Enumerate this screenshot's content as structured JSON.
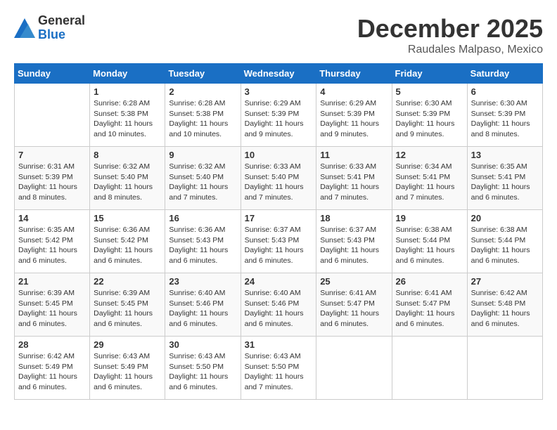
{
  "logo": {
    "general": "General",
    "blue": "Blue"
  },
  "title": {
    "month": "December 2025",
    "location": "Raudales Malpaso, Mexico"
  },
  "headers": [
    "Sunday",
    "Monday",
    "Tuesday",
    "Wednesday",
    "Thursday",
    "Friday",
    "Saturday"
  ],
  "weeks": [
    [
      {
        "day": "",
        "sunrise": "",
        "sunset": "",
        "daylight": ""
      },
      {
        "day": "1",
        "sunrise": "Sunrise: 6:28 AM",
        "sunset": "Sunset: 5:38 PM",
        "daylight": "Daylight: 11 hours and 10 minutes."
      },
      {
        "day": "2",
        "sunrise": "Sunrise: 6:28 AM",
        "sunset": "Sunset: 5:38 PM",
        "daylight": "Daylight: 11 hours and 10 minutes."
      },
      {
        "day": "3",
        "sunrise": "Sunrise: 6:29 AM",
        "sunset": "Sunset: 5:39 PM",
        "daylight": "Daylight: 11 hours and 9 minutes."
      },
      {
        "day": "4",
        "sunrise": "Sunrise: 6:29 AM",
        "sunset": "Sunset: 5:39 PM",
        "daylight": "Daylight: 11 hours and 9 minutes."
      },
      {
        "day": "5",
        "sunrise": "Sunrise: 6:30 AM",
        "sunset": "Sunset: 5:39 PM",
        "daylight": "Daylight: 11 hours and 9 minutes."
      },
      {
        "day": "6",
        "sunrise": "Sunrise: 6:30 AM",
        "sunset": "Sunset: 5:39 PM",
        "daylight": "Daylight: 11 hours and 8 minutes."
      }
    ],
    [
      {
        "day": "7",
        "sunrise": "Sunrise: 6:31 AM",
        "sunset": "Sunset: 5:39 PM",
        "daylight": "Daylight: 11 hours and 8 minutes."
      },
      {
        "day": "8",
        "sunrise": "Sunrise: 6:32 AM",
        "sunset": "Sunset: 5:40 PM",
        "daylight": "Daylight: 11 hours and 8 minutes."
      },
      {
        "day": "9",
        "sunrise": "Sunrise: 6:32 AM",
        "sunset": "Sunset: 5:40 PM",
        "daylight": "Daylight: 11 hours and 7 minutes."
      },
      {
        "day": "10",
        "sunrise": "Sunrise: 6:33 AM",
        "sunset": "Sunset: 5:40 PM",
        "daylight": "Daylight: 11 hours and 7 minutes."
      },
      {
        "day": "11",
        "sunrise": "Sunrise: 6:33 AM",
        "sunset": "Sunset: 5:41 PM",
        "daylight": "Daylight: 11 hours and 7 minutes."
      },
      {
        "day": "12",
        "sunrise": "Sunrise: 6:34 AM",
        "sunset": "Sunset: 5:41 PM",
        "daylight": "Daylight: 11 hours and 7 minutes."
      },
      {
        "day": "13",
        "sunrise": "Sunrise: 6:35 AM",
        "sunset": "Sunset: 5:41 PM",
        "daylight": "Daylight: 11 hours and 6 minutes."
      }
    ],
    [
      {
        "day": "14",
        "sunrise": "Sunrise: 6:35 AM",
        "sunset": "Sunset: 5:42 PM",
        "daylight": "Daylight: 11 hours and 6 minutes."
      },
      {
        "day": "15",
        "sunrise": "Sunrise: 6:36 AM",
        "sunset": "Sunset: 5:42 PM",
        "daylight": "Daylight: 11 hours and 6 minutes."
      },
      {
        "day": "16",
        "sunrise": "Sunrise: 6:36 AM",
        "sunset": "Sunset: 5:43 PM",
        "daylight": "Daylight: 11 hours and 6 minutes."
      },
      {
        "day": "17",
        "sunrise": "Sunrise: 6:37 AM",
        "sunset": "Sunset: 5:43 PM",
        "daylight": "Daylight: 11 hours and 6 minutes."
      },
      {
        "day": "18",
        "sunrise": "Sunrise: 6:37 AM",
        "sunset": "Sunset: 5:43 PM",
        "daylight": "Daylight: 11 hours and 6 minutes."
      },
      {
        "day": "19",
        "sunrise": "Sunrise: 6:38 AM",
        "sunset": "Sunset: 5:44 PM",
        "daylight": "Daylight: 11 hours and 6 minutes."
      },
      {
        "day": "20",
        "sunrise": "Sunrise: 6:38 AM",
        "sunset": "Sunset: 5:44 PM",
        "daylight": "Daylight: 11 hours and 6 minutes."
      }
    ],
    [
      {
        "day": "21",
        "sunrise": "Sunrise: 6:39 AM",
        "sunset": "Sunset: 5:45 PM",
        "daylight": "Daylight: 11 hours and 6 minutes."
      },
      {
        "day": "22",
        "sunrise": "Sunrise: 6:39 AM",
        "sunset": "Sunset: 5:45 PM",
        "daylight": "Daylight: 11 hours and 6 minutes."
      },
      {
        "day": "23",
        "sunrise": "Sunrise: 6:40 AM",
        "sunset": "Sunset: 5:46 PM",
        "daylight": "Daylight: 11 hours and 6 minutes."
      },
      {
        "day": "24",
        "sunrise": "Sunrise: 6:40 AM",
        "sunset": "Sunset: 5:46 PM",
        "daylight": "Daylight: 11 hours and 6 minutes."
      },
      {
        "day": "25",
        "sunrise": "Sunrise: 6:41 AM",
        "sunset": "Sunset: 5:47 PM",
        "daylight": "Daylight: 11 hours and 6 minutes."
      },
      {
        "day": "26",
        "sunrise": "Sunrise: 6:41 AM",
        "sunset": "Sunset: 5:47 PM",
        "daylight": "Daylight: 11 hours and 6 minutes."
      },
      {
        "day": "27",
        "sunrise": "Sunrise: 6:42 AM",
        "sunset": "Sunset: 5:48 PM",
        "daylight": "Daylight: 11 hours and 6 minutes."
      }
    ],
    [
      {
        "day": "28",
        "sunrise": "Sunrise: 6:42 AM",
        "sunset": "Sunset: 5:49 PM",
        "daylight": "Daylight: 11 hours and 6 minutes."
      },
      {
        "day": "29",
        "sunrise": "Sunrise: 6:43 AM",
        "sunset": "Sunset: 5:49 PM",
        "daylight": "Daylight: 11 hours and 6 minutes."
      },
      {
        "day": "30",
        "sunrise": "Sunrise: 6:43 AM",
        "sunset": "Sunset: 5:50 PM",
        "daylight": "Daylight: 11 hours and 6 minutes."
      },
      {
        "day": "31",
        "sunrise": "Sunrise: 6:43 AM",
        "sunset": "Sunset: 5:50 PM",
        "daylight": "Daylight: 11 hours and 7 minutes."
      },
      {
        "day": "",
        "sunrise": "",
        "sunset": "",
        "daylight": ""
      },
      {
        "day": "",
        "sunrise": "",
        "sunset": "",
        "daylight": ""
      },
      {
        "day": "",
        "sunrise": "",
        "sunset": "",
        "daylight": ""
      }
    ]
  ]
}
